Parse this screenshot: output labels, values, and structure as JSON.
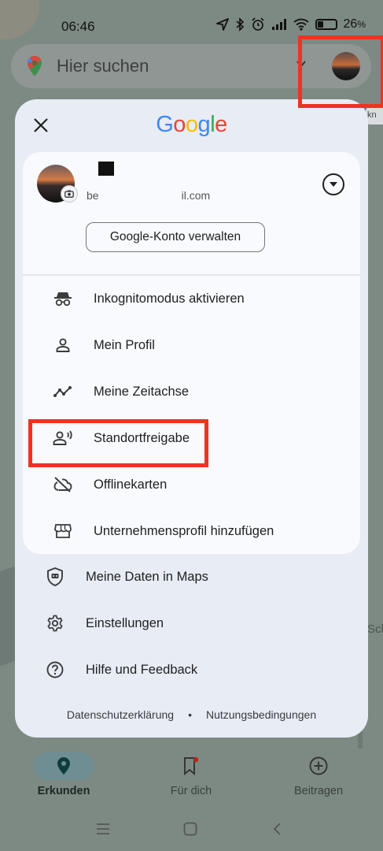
{
  "status_bar": {
    "time": "06:46",
    "battery": "26",
    "battery_unit": "%"
  },
  "search": {
    "placeholder": "Hier suchen"
  },
  "sheet": {
    "brand": [
      "G",
      "o",
      "o",
      "g",
      "l",
      "e"
    ],
    "brand_colors": [
      "#4285F4",
      "#EA4335",
      "#FBBC05",
      "#4285F4",
      "#34A853",
      "#EA4335"
    ],
    "account": {
      "email_prefix": "be",
      "email_suffix": "il.com",
      "manage_label": "Google-Konto verwalten"
    },
    "card_items": [
      {
        "label": "Inkognitomodus aktivieren",
        "icon": "incognito-icon"
      },
      {
        "label": "Mein Profil",
        "icon": "person-icon"
      },
      {
        "label": "Meine Zeitachse",
        "icon": "timeline-icon"
      },
      {
        "label": "Standortfreigabe",
        "icon": "location-sharing-icon"
      },
      {
        "label": "Offlinekarten",
        "icon": "cloud-off-icon"
      },
      {
        "label": "Unternehmensprofil hinzufügen",
        "icon": "storefront-icon"
      }
    ],
    "items": [
      {
        "label": "Meine Daten in Maps",
        "icon": "shield-data-icon"
      },
      {
        "label": "Einstellungen",
        "icon": "gear-icon"
      },
      {
        "label": "Hilfe und Feedback",
        "icon": "help-icon"
      }
    ],
    "footer": {
      "privacy": "Datenschutzerklärung",
      "separator": "•",
      "terms": "Nutzungsbedingungen"
    }
  },
  "bottom_nav": [
    {
      "label": "Erkunden",
      "icon": "explore-pin-icon",
      "active": true
    },
    {
      "label": "Für dich",
      "icon": "bookmark-icon",
      "active": false
    },
    {
      "label": "Beitragen",
      "icon": "add-circle-icon",
      "active": false
    }
  ],
  "map": {
    "edge_label": "Sch",
    "badge": "kn"
  },
  "colors": {
    "highlight": "#ee3322",
    "sheet_bg": "#e7ecf5",
    "card_bg": "#f8fafd"
  }
}
